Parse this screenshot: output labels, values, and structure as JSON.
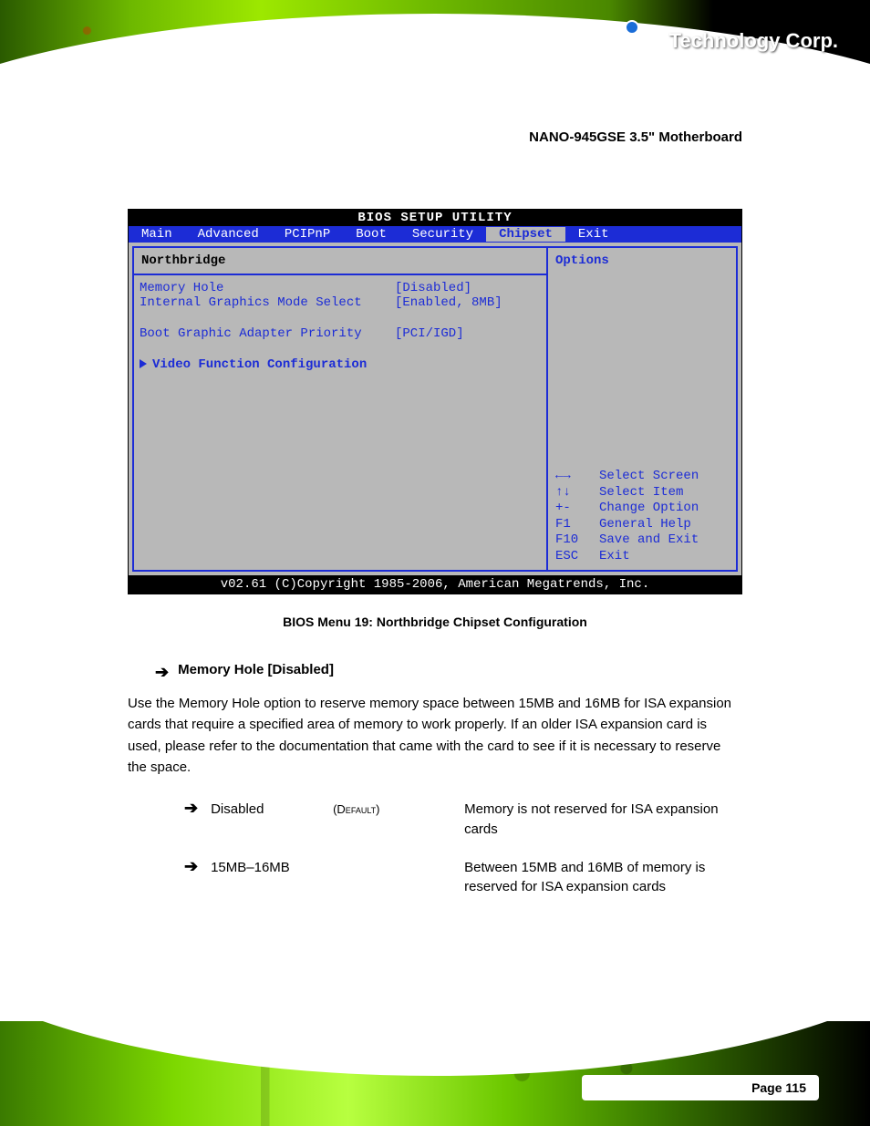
{
  "brand": {
    "logo_text": "Technology Corp.",
    "reg": "®"
  },
  "product_title": "NANO-945GSE 3.5\" Motherboard",
  "bios": {
    "window_title": "BIOS SETUP UTILITY",
    "tabs": [
      "Main",
      "Advanced",
      "PCIPnP",
      "Boot",
      "Security",
      "Chipset",
      "Exit"
    ],
    "active_tab": "Chipset",
    "section": "Northbridge",
    "rows": [
      {
        "label": "Memory Hole",
        "value": "[Disabled]"
      },
      {
        "label": "Internal Graphics Mode Select",
        "value": "[Enabled, 8MB]"
      }
    ],
    "rows2": [
      {
        "label": "Boot Graphic Adapter Priority",
        "value": "[PCI/IGD]"
      }
    ],
    "submenu": "Video Function Configuration",
    "right_title": "Options",
    "keyhelp": [
      {
        "k": "←→",
        "d": "Select Screen"
      },
      {
        "k": "↑↓",
        "d": "Select Item"
      },
      {
        "k": "+-",
        "d": "Change Option"
      },
      {
        "k": "F1",
        "d": "General Help"
      },
      {
        "k": "F10",
        "d": "Save and Exit"
      },
      {
        "k": "ESC",
        "d": "Exit"
      }
    ],
    "footer": "v02.61 (C)Copyright 1985-2006, American Megatrends, Inc."
  },
  "caption": "BIOS Menu 19: Northbridge Chipset Configuration",
  "memhole": {
    "heading": "Memory Hole [Disabled]",
    "para": "Use the Memory Hole option to reserve memory space between 15MB and 16MB for ISA expansion cards that require a specified area of memory to work properly. If an older ISA expansion card is used, please refer to the documentation that came with the card to see if it is necessary to reserve the space.",
    "opts": [
      {
        "key": "Disabled",
        "def": "(Default)",
        "desc": "Memory is not reserved for ISA expansion cards"
      },
      {
        "key": "15MB–16MB",
        "def": "",
        "desc": "Between 15MB and 16MB of memory is reserved for ISA expansion cards"
      }
    ]
  },
  "page_label": "Page 115"
}
